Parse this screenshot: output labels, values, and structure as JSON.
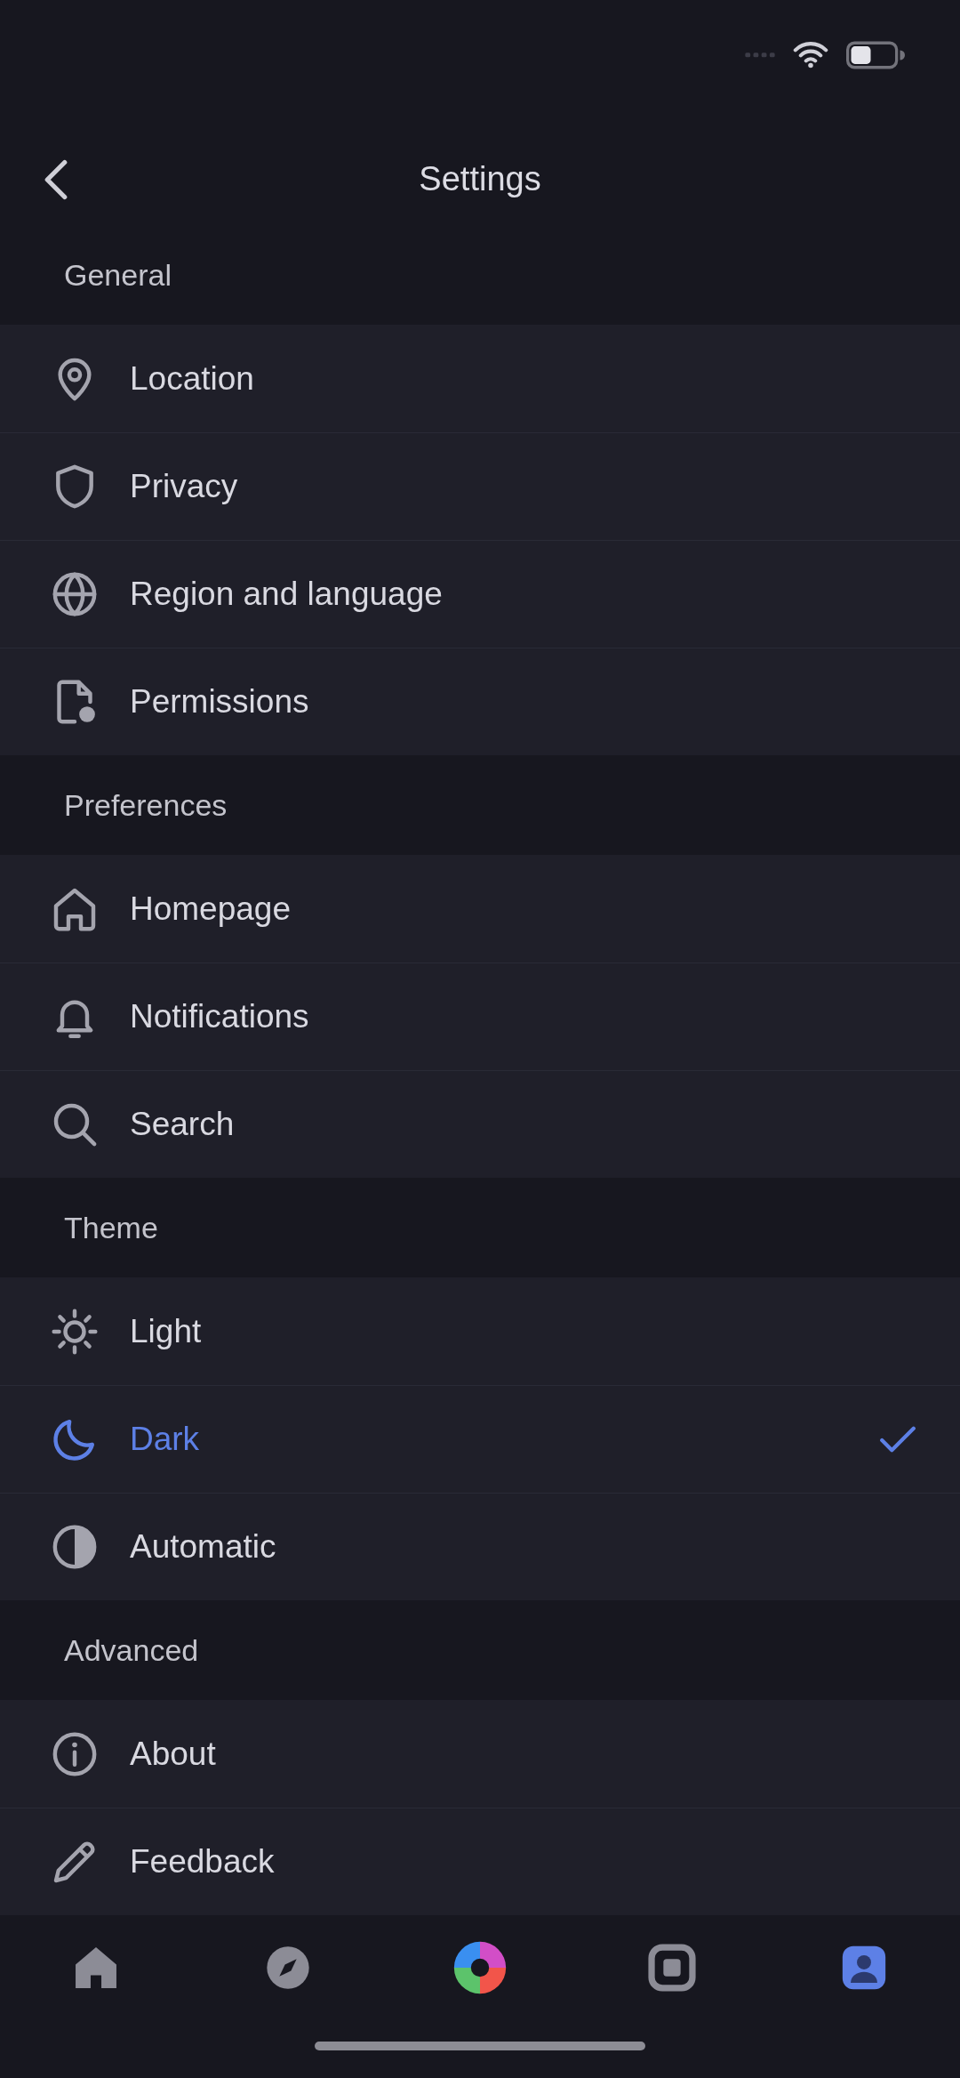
{
  "header": {
    "title": "Settings"
  },
  "sections": [
    {
      "title": "General",
      "items": [
        {
          "label": "Location"
        },
        {
          "label": "Privacy"
        },
        {
          "label": "Region and language"
        },
        {
          "label": "Permissions"
        }
      ]
    },
    {
      "title": "Preferences",
      "items": [
        {
          "label": "Homepage"
        },
        {
          "label": "Notifications"
        },
        {
          "label": "Search"
        }
      ]
    },
    {
      "title": "Theme",
      "items": [
        {
          "label": "Light",
          "selected": false
        },
        {
          "label": "Dark",
          "selected": true
        },
        {
          "label": "Automatic",
          "selected": false
        }
      ]
    },
    {
      "title": "Advanced",
      "items": [
        {
          "label": "About"
        },
        {
          "label": "Feedback"
        }
      ]
    }
  ],
  "bottom_nav": [
    {
      "selected": false
    },
    {
      "selected": false
    },
    {
      "selected": false
    },
    {
      "selected": false
    },
    {
      "selected": true
    }
  ]
}
